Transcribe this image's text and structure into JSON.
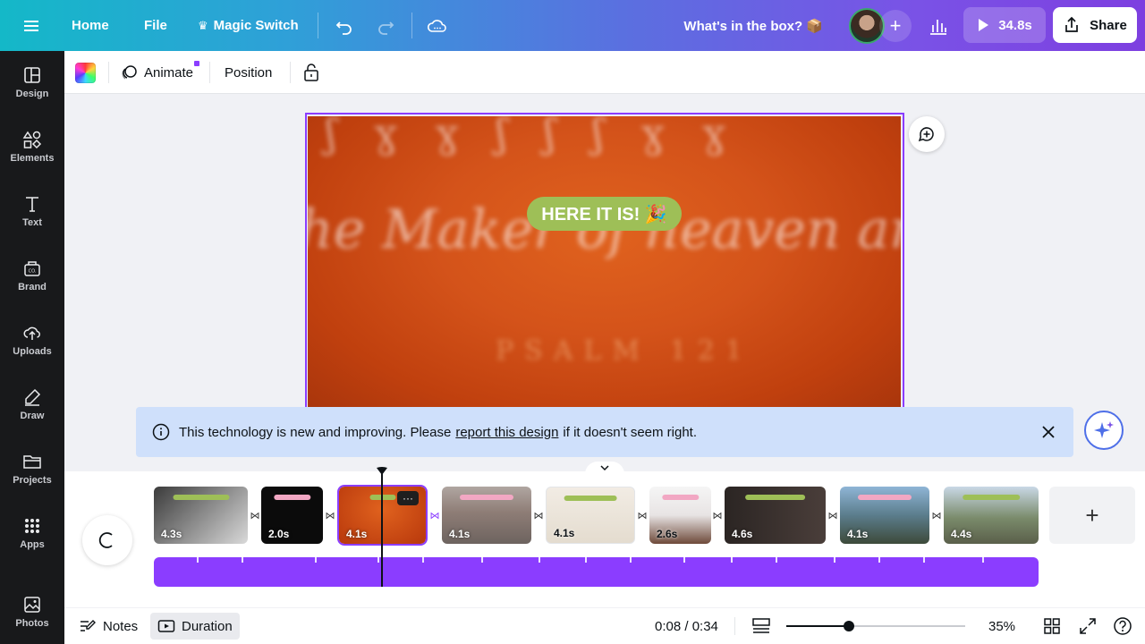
{
  "topbar": {
    "menu_icon": "hamburger-icon",
    "home_label": "Home",
    "file_label": "File",
    "magic_switch_label": "Magic Switch",
    "design_title": "What's in the box? 📦",
    "play_label": "34.8s",
    "share_label": "Share"
  },
  "sidebar": {
    "items": [
      {
        "label": "Design",
        "icon": "design-icon"
      },
      {
        "label": "Elements",
        "icon": "elements-icon"
      },
      {
        "label": "Text",
        "icon": "text-icon"
      },
      {
        "label": "Brand",
        "icon": "brand-icon"
      },
      {
        "label": "Uploads",
        "icon": "uploads-icon"
      },
      {
        "label": "Draw",
        "icon": "draw-icon"
      },
      {
        "label": "Projects",
        "icon": "projects-icon"
      },
      {
        "label": "Apps",
        "icon": "apps-icon"
      },
      {
        "label": "Photos",
        "icon": "photos-icon"
      }
    ]
  },
  "context_toolbar": {
    "animate_label": "Animate",
    "position_label": "Position"
  },
  "canvas": {
    "badge_text": "HERE IT IS! 🎉",
    "background_color": "#d4531a",
    "badge_color": "#9ebf57"
  },
  "notice": {
    "text_before": "This technology is new and improving. Please",
    "link_text": "report this design",
    "text_after": "if it doesn't seem right."
  },
  "timeline": {
    "clips": [
      {
        "duration": "4.3s"
      },
      {
        "duration": "2.0s"
      },
      {
        "duration": "4.1s",
        "selected": true
      },
      {
        "duration": "4.1s"
      },
      {
        "duration": "4.1s"
      },
      {
        "duration": "2.6s"
      },
      {
        "duration": "4.6s"
      },
      {
        "duration": "4.1s"
      },
      {
        "duration": "4.4s"
      }
    ],
    "add_label": "+"
  },
  "bottombar": {
    "notes_label": "Notes",
    "duration_label": "Duration",
    "time": "0:08 / 0:34",
    "zoom": "35%",
    "zoom_level": 0.35
  },
  "colors": {
    "accent": "#8b3dff",
    "sidebar_bg": "#18191b"
  }
}
